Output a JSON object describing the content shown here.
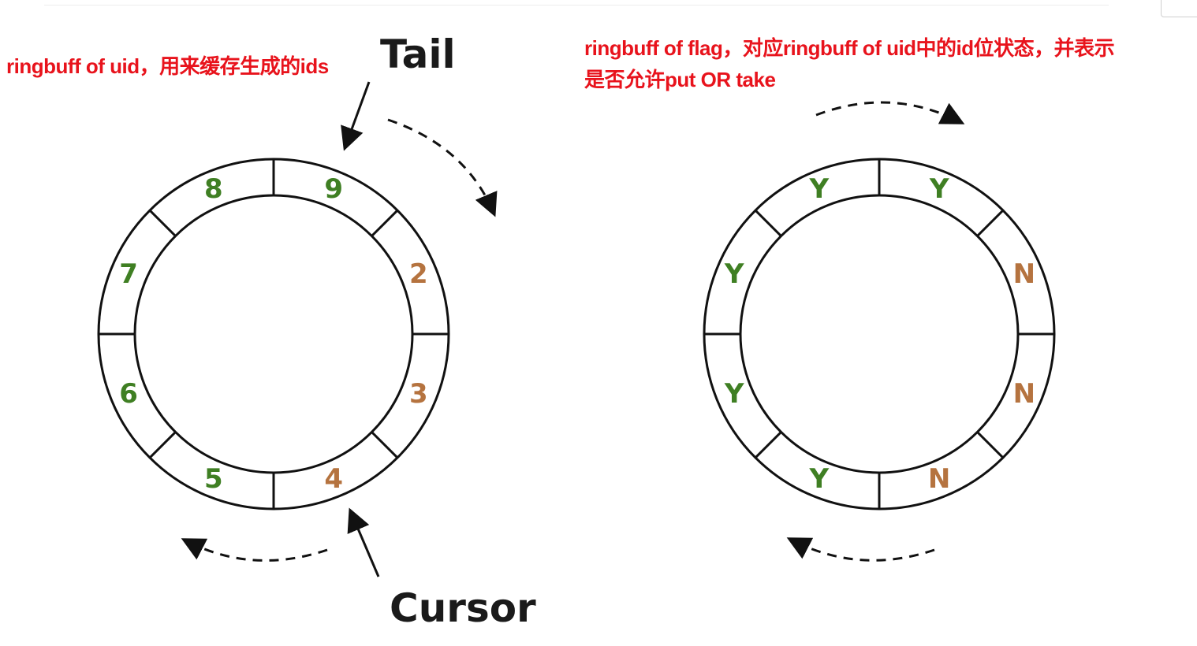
{
  "annotations": {
    "left": "ringbuff of uid，用来缓存生成的ids",
    "right_line1": "ringbuff of flag，对应ringbuff of uid中的id位状态，并表示",
    "right_line2": "是否允许put OR take"
  },
  "labels": {
    "tail": "Tail",
    "cursor": "Cursor"
  },
  "uid_ring": {
    "slots": [
      {
        "value": "9",
        "state": "filled"
      },
      {
        "value": "2",
        "state": "pending"
      },
      {
        "value": "3",
        "state": "pending"
      },
      {
        "value": "4",
        "state": "pending"
      },
      {
        "value": "5",
        "state": "filled"
      },
      {
        "value": "6",
        "state": "filled"
      },
      {
        "value": "7",
        "state": "filled"
      },
      {
        "value": "8",
        "state": "filled"
      }
    ]
  },
  "flag_ring": {
    "slots": [
      {
        "value": "Y",
        "state": "filled"
      },
      {
        "value": "N",
        "state": "pending"
      },
      {
        "value": "N",
        "state": "pending"
      },
      {
        "value": "N",
        "state": "pending"
      },
      {
        "value": "Y",
        "state": "filled"
      },
      {
        "value": "Y",
        "state": "filled"
      },
      {
        "value": "Y",
        "state": "filled"
      },
      {
        "value": "Y",
        "state": "filled"
      }
    ]
  },
  "colors": {
    "filled": "#3f7f23",
    "pending": "#b5733f",
    "annotation": "#e8131c",
    "line": "#111111"
  }
}
